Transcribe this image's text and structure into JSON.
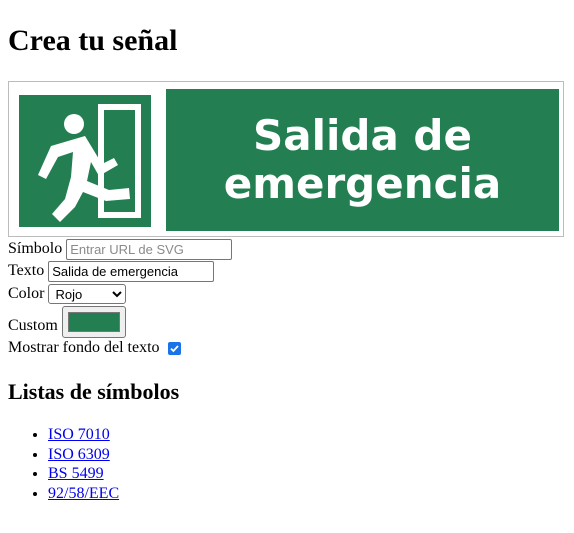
{
  "page": {
    "title": "Crea tu señal"
  },
  "sign": {
    "text_line1": "Salida de",
    "text_line2": "emergencia",
    "color": "#237f52",
    "symbol_icon": "emergency-exit-running-person-icon"
  },
  "form": {
    "symbol_label": "Símbolo",
    "symbol_placeholder": "Entrar URL de SVG",
    "text_label": "Texto",
    "text_value": "Salida de emergencia",
    "color_label": "Color",
    "color_selected": "Rojo",
    "custom_label": "Custom",
    "custom_color": "#237f52",
    "show_bg_label": "Mostrar fondo del texto",
    "show_bg_checked": true,
    "checkbox_color": "#1a73e8"
  },
  "symbol_lists": {
    "heading": "Listas de símbolos",
    "items": [
      {
        "label": "ISO 7010"
      },
      {
        "label": "ISO 6309"
      },
      {
        "label": "BS 5499"
      },
      {
        "label": "92/58/EEC"
      }
    ]
  }
}
